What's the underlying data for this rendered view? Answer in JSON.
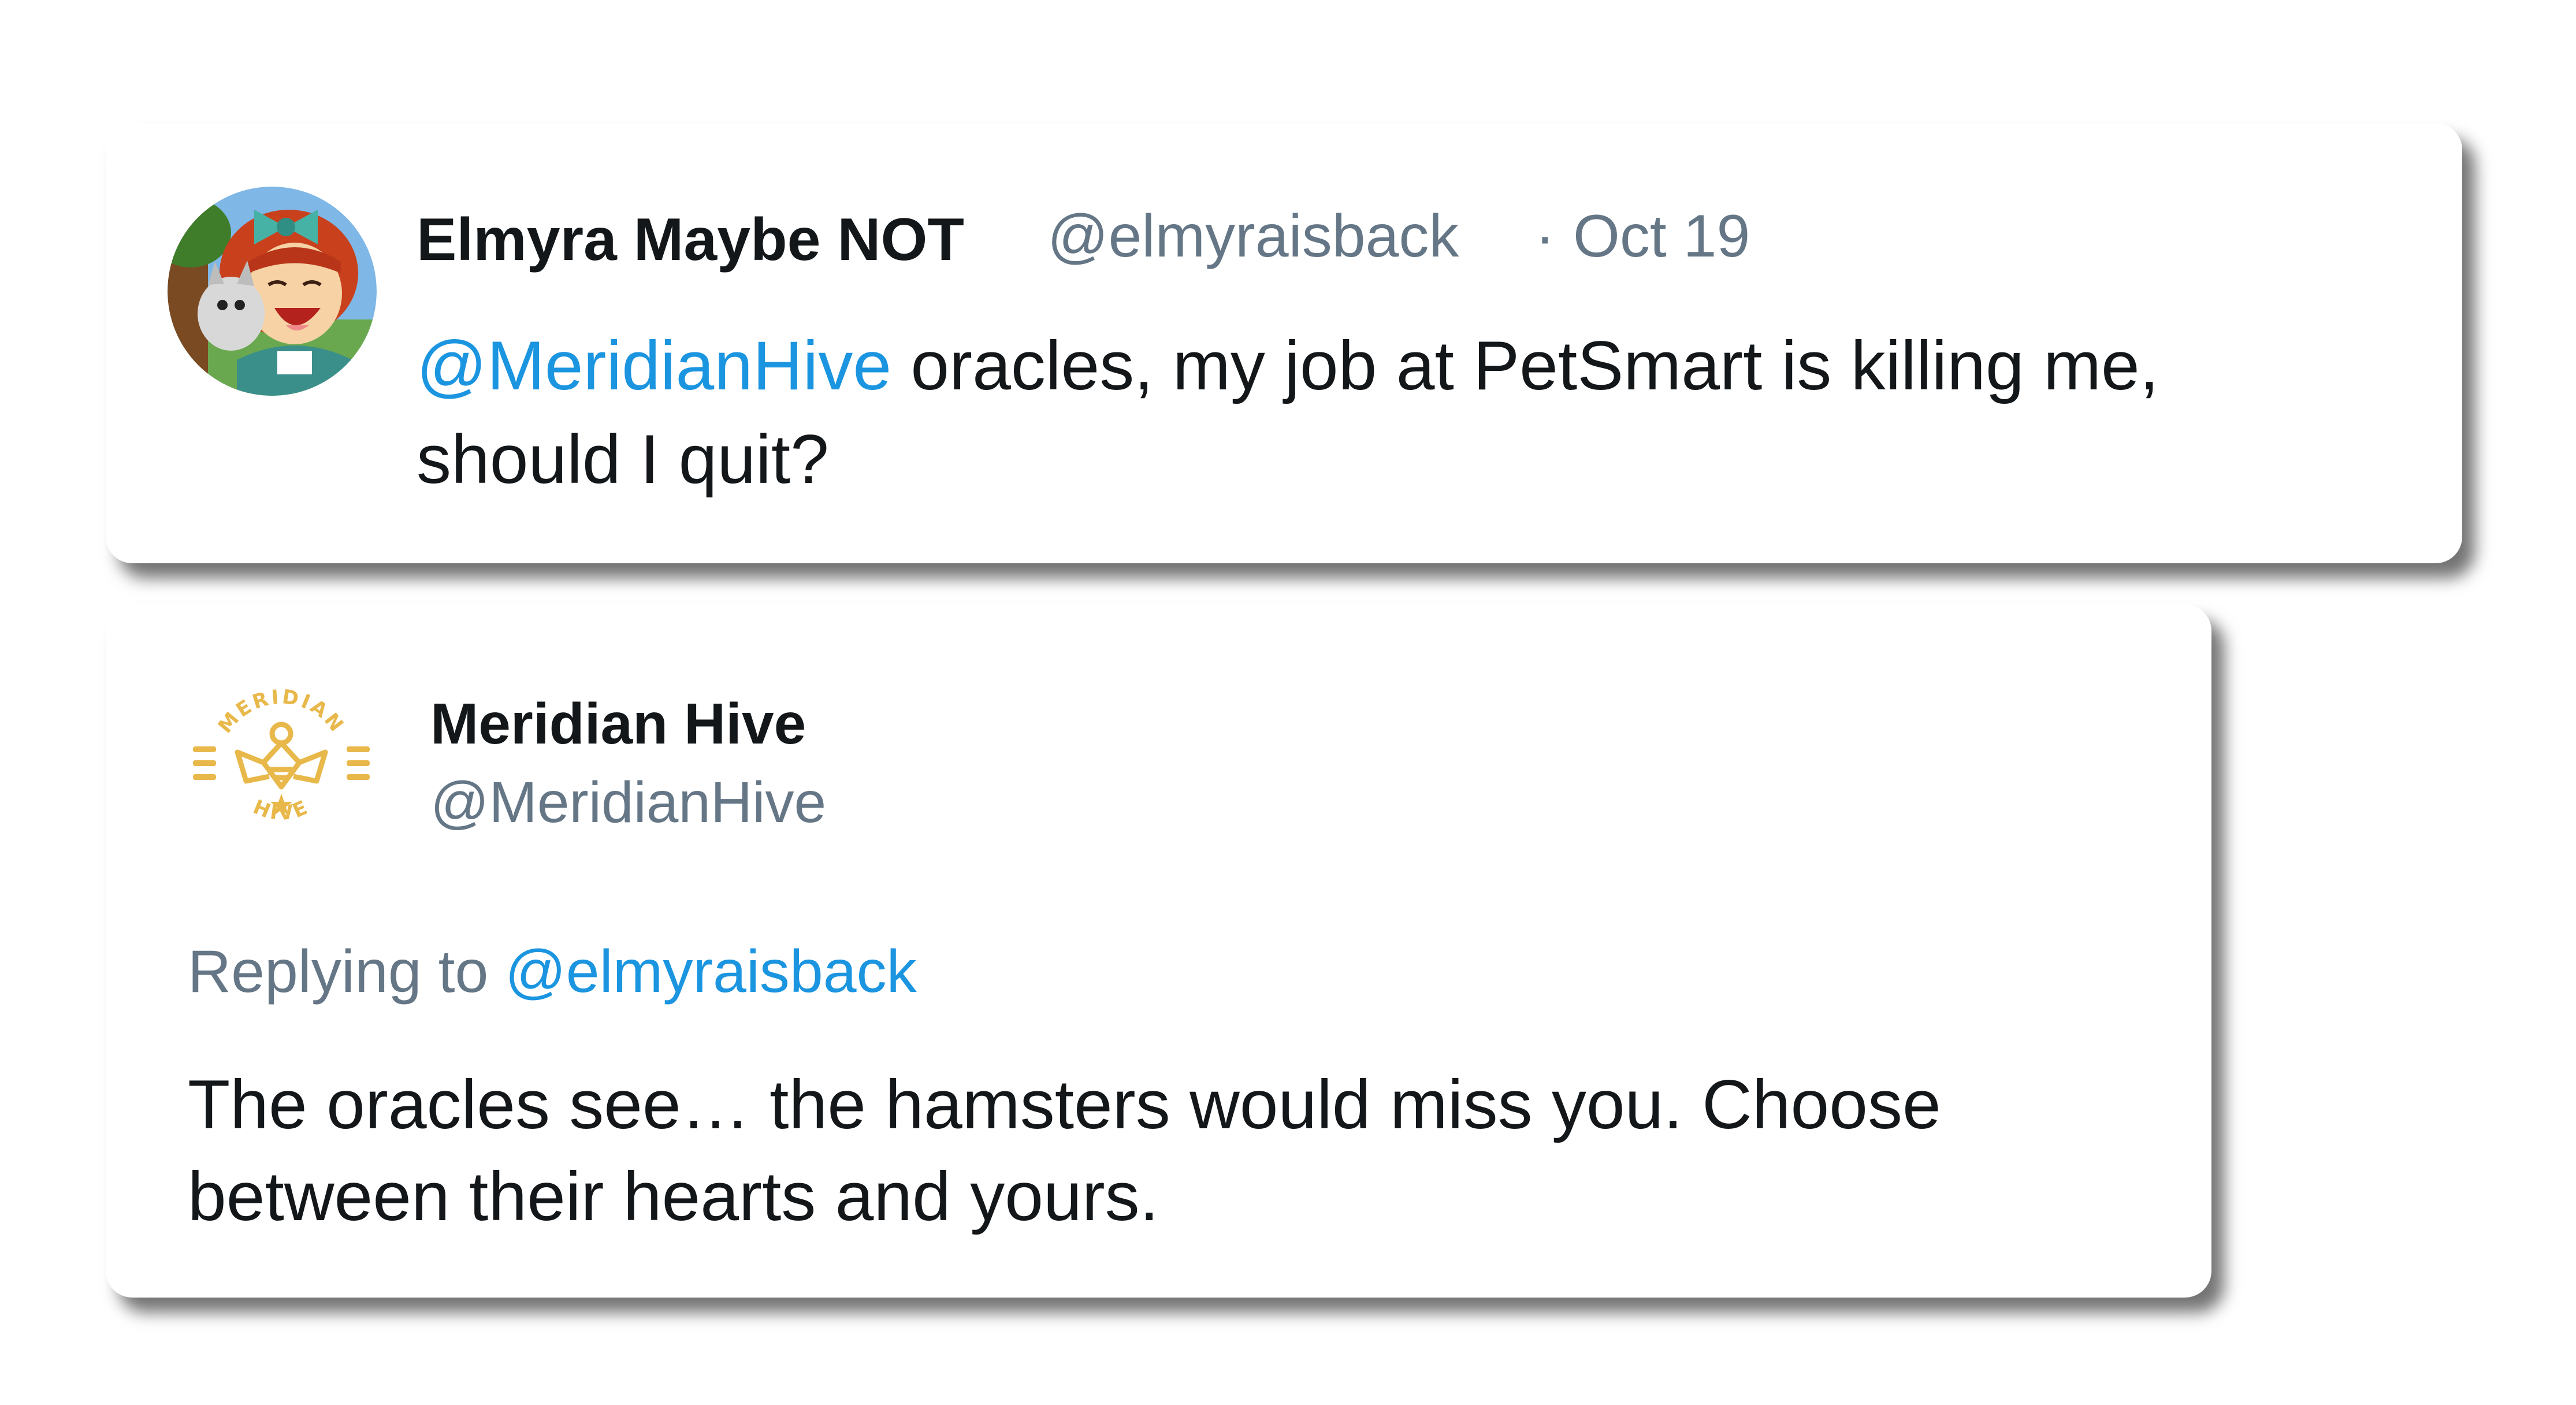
{
  "tweet": {
    "author_name": "Elmyra Maybe NOT",
    "author_handle": "@elmyraisback",
    "separator": "·",
    "date": "Oct 19",
    "mention": "@MeridianHive",
    "text_line1_rest": " oracles, my job at PetSmart is killing me,",
    "text_line2": "should I quit?",
    "avatar_icon": "cartoon-girl-avatar"
  },
  "reply": {
    "author_name": "Meridian Hive",
    "author_handle": "@MeridianHive",
    "logo_text_top": "MERIDIAN",
    "logo_text_bottom": "HIVE",
    "replying_label": "Replying to ",
    "replying_to": "@elmyraisback",
    "text_line1": "The oracles see… the hamsters would miss you. Choose",
    "text_line2": "between their hearts and yours.",
    "avatar_icon": "bee-logo-avatar"
  },
  "colors": {
    "text_primary": "#14171a",
    "text_secondary": "#657786",
    "link": "#1b95e0",
    "logo_gold": "#e8b84a"
  }
}
